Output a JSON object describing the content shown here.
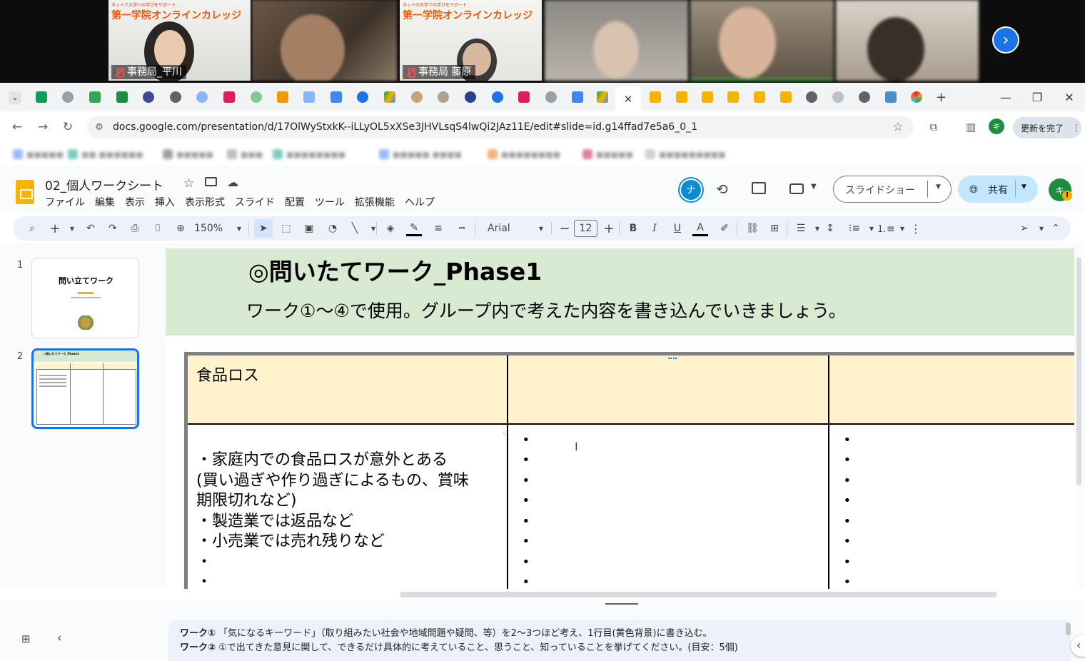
{
  "video": {
    "tiles": [
      {
        "name": "事務局_平川",
        "banner": "第一学院オンラインカレッジ",
        "banner_sub": "ネットで大学への学びをサポート",
        "muted": true
      },
      {
        "name": "",
        "banner": "",
        "muted": false
      },
      {
        "name": "事務局 藤原",
        "banner": "第一学院オンラインカレッジ",
        "banner_sub": "ネットの大学での学びをサポート",
        "muted": true
      },
      {
        "name": "",
        "muted": false
      },
      {
        "name": "",
        "muted": false
      },
      {
        "name": "",
        "muted": false
      }
    ],
    "next_icon": "chevron-right-icon"
  },
  "browser": {
    "url": "docs.google.com/presentation/d/17OlWyStxkK--iLLyOL5xXSe3JHVLsqS4lwQi2JAz11E/edit#slide=id.g14ffad7e5a6_0_1",
    "update_button": "更新を完了",
    "profile_initial": "キ",
    "new_tab": "+"
  },
  "app": {
    "doc_title": "02_個人ワークシート",
    "menus": [
      "ファイル",
      "編集",
      "表示",
      "挿入",
      "表示形式",
      "スライド",
      "配置",
      "ツール",
      "拡張機能",
      "ヘルプ"
    ],
    "collaborator_initial": "ナ",
    "present_label": "スライドショー",
    "share_label": "共有",
    "user_initial": "キ"
  },
  "toolbar": {
    "zoom": "150%",
    "font": "Arial",
    "font_size": "12",
    "bold": "B",
    "italic": "I",
    "underline": "U",
    "text_color": "A"
  },
  "filmstrip": {
    "slides": [
      {
        "number": "1",
        "title": "問い立てワーク"
      },
      {
        "number": "2",
        "title": "◎問いたてワーク_Phase1"
      }
    ]
  },
  "slide": {
    "title": "◎問いたてワーク_Phase1",
    "subtitle": "ワーク①〜④で使用。グループ内で考えた内容を書き込んでいきましょう。",
    "table": {
      "headers": [
        "食品ロス",
        "",
        ""
      ],
      "col1_lines": [
        "",
        "・家庭内での食品ロスが意外とある",
        "(買い過ぎや作り過ぎによるもの、賞味",
        "期限切れなど)",
        "・製造業では返品など",
        "・小売業では売れ残りなど",
        "・",
        "・"
      ],
      "bullet": "•"
    }
  },
  "notes": {
    "line1_label": "ワーク①",
    "line1_text": "「気になるキーワード」（取り組みたい社会や地域問題や疑問、等）を2〜3つほど考え、1行目(黄色背景)に書き込む。",
    "line2_label": "ワーク②",
    "line2_text": "①で出てきた意見に関して、できるだけ具体的に考えていること、思うこと、知っていることを挙げてください。(目安：5個)"
  },
  "colors": {
    "slide_header_bg": "#d9ead3",
    "table_header_bg": "#fff2cc",
    "share_bg": "#c2e7ff",
    "accent": "#1a73e8"
  }
}
